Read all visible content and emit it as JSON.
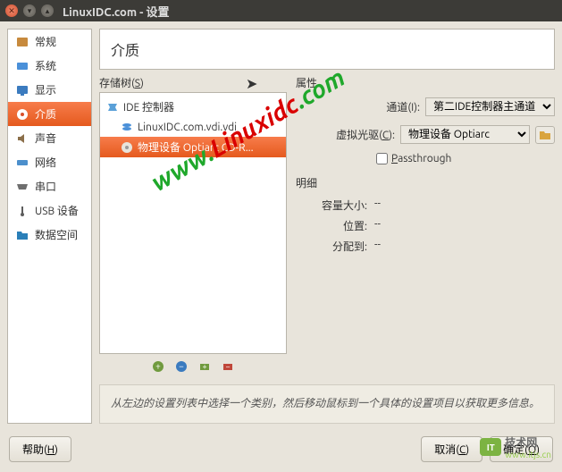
{
  "window": {
    "title": "LinuxIDC.com - 设置"
  },
  "sidebar": {
    "items": [
      {
        "label": "常规",
        "icon": "#c78a3d"
      },
      {
        "label": "系统",
        "icon": "#4a90d9"
      },
      {
        "label": "显示",
        "icon": "#3b7bbf"
      },
      {
        "label": "介质",
        "icon": "#d94f2a"
      },
      {
        "label": "声音",
        "icon": "#8b6f4a"
      },
      {
        "label": "网络",
        "icon": "#4c8fcc"
      },
      {
        "label": "串口",
        "icon": "#6e6e6e"
      },
      {
        "label": "USB 设备",
        "icon": "#5c5c5c"
      },
      {
        "label": "数据空间",
        "icon": "#2a7fb8"
      }
    ]
  },
  "header": {
    "title": "介质"
  },
  "storage": {
    "tree_label_prefix": "存储树(",
    "tree_label_key": "S",
    "tree_label_suffix": ")",
    "controller": "IDE 控制器",
    "disk": "LinuxIDC.com.vdi.vdi",
    "cd": "物理设备 Optiarc CD-R..."
  },
  "properties": {
    "title": "属性",
    "channel_label": "通道(I):",
    "channel_value": "第二IDE控制器主通道",
    "drive_label": "虚拟光驱(",
    "drive_key": "C",
    "drive_suffix": "):",
    "drive_value": "物理设备 Optiarc",
    "passthrough_prefix": "",
    "passthrough_key": "P",
    "passthrough_rest": "assthrough"
  },
  "details": {
    "title": "明细",
    "size_label": "容量大小:",
    "size_value": "--",
    "location_label": "位置:",
    "location_value": "--",
    "attached_label": "分配到:",
    "attached_value": "--"
  },
  "hint": "从左边的设置列表中选择一个类别，然后移动鼠标到一个具体的设置项目以获取更多信息。",
  "footer": {
    "help_prefix": "帮助(",
    "help_key": "H",
    "help_suffix": ")",
    "cancel_prefix": "取消(",
    "cancel_key": "C",
    "cancel_suffix": ")",
    "ok_prefix": "确定(",
    "ok_key": "O",
    "ok_suffix": ")"
  },
  "watermark": {
    "text1a": "www.",
    "text1b": "Linuxidc",
    "text1c": ".com",
    "brand": "IT",
    "brand2": "技术网",
    "url": "www.itjs.cn"
  }
}
